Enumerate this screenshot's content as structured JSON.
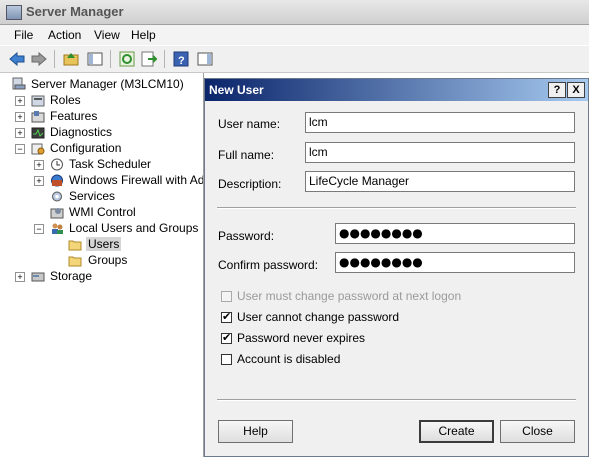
{
  "window": {
    "title": "Server Manager"
  },
  "menu": [
    "File",
    "Action",
    "View",
    "Help"
  ],
  "tree": {
    "root": "Server Manager (M3LCM10)",
    "roles": "Roles",
    "features": "Features",
    "diagnostics": "Diagnostics",
    "configuration": "Configuration",
    "task_scheduler": "Task Scheduler",
    "firewall": "Windows Firewall with Adva",
    "services": "Services",
    "wmi": "WMI Control",
    "local_users_groups": "Local Users and Groups",
    "users": "Users",
    "groups": "Groups",
    "storage": "Storage"
  },
  "dialog": {
    "title": "New User",
    "help_glyph": "?",
    "close_glyph": "X",
    "username_label": "User name:",
    "username_value": "lcm",
    "fullname_label": "Full name:",
    "fullname_value": "lcm",
    "description_label": "Description:",
    "description_value": "LifeCycle Manager",
    "password_label": "Password:",
    "password_value": "●●●●●●●●",
    "confirm_label": "Confirm password:",
    "confirm_value": "●●●●●●●●",
    "options": {
      "must_change": {
        "label": "User must change password at next logon",
        "checked": false,
        "enabled": false
      },
      "cannot_change": {
        "label": "User cannot change password",
        "checked": true,
        "enabled": true
      },
      "never_expires": {
        "label": "Password never expires",
        "checked": true,
        "enabled": true
      },
      "disabled": {
        "label": "Account is disabled",
        "checked": false,
        "enabled": true
      }
    },
    "buttons": {
      "help": "Help",
      "create": "Create",
      "close": "Close"
    }
  },
  "check_glyph": "✔"
}
